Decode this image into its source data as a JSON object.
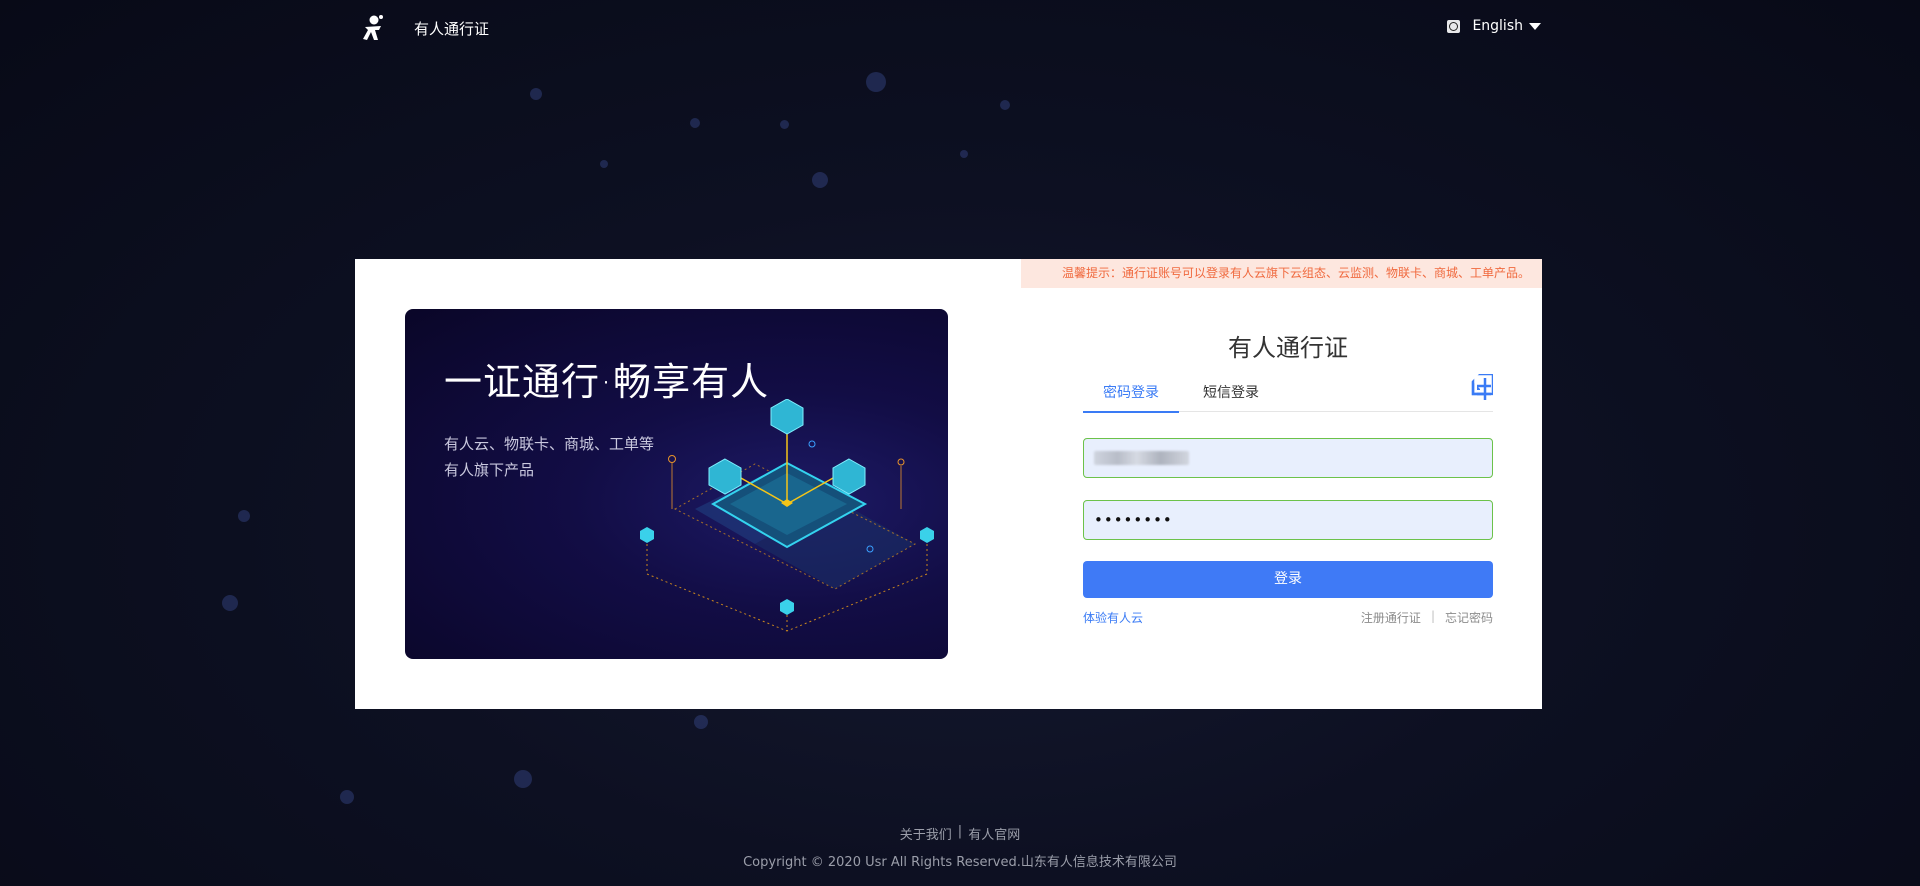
{
  "header": {
    "brand_title": "有人通行证",
    "language": "English"
  },
  "notice": {
    "text": "温馨提示：通行证账号可以登录有人云旗下云组态、云监测、物联卡、商城、工单产品。"
  },
  "promo": {
    "heading": "一证通行·畅享有人",
    "description": "有人云、物联卡、商城、工单等有人旗下产品"
  },
  "login": {
    "title": "有人通行证",
    "tabs": [
      {
        "label": "密码登录",
        "active": true
      },
      {
        "label": "短信登录",
        "active": false
      }
    ],
    "password_value": "••••••••",
    "submit_label": "登录",
    "trial_link": "体验有人云",
    "register_link": "注册通行证",
    "separator": "|",
    "forgot_link": "忘记密码"
  },
  "footer": {
    "about": "关于我们",
    "separator": "|",
    "official_site": "有人官网",
    "copyright": "Copyright © 2020 Usr All Rights Reserved.山东有人信息技术有限公司"
  },
  "colors": {
    "accent": "#3f7af6",
    "notice_text": "#f0693e",
    "notice_bg": "#fde7df",
    "field_border": "#6cc24a",
    "field_bg": "#e8effd"
  },
  "icons": [
    "logo-icon",
    "globe-icon",
    "caret-down-icon",
    "qr-code-icon"
  ]
}
